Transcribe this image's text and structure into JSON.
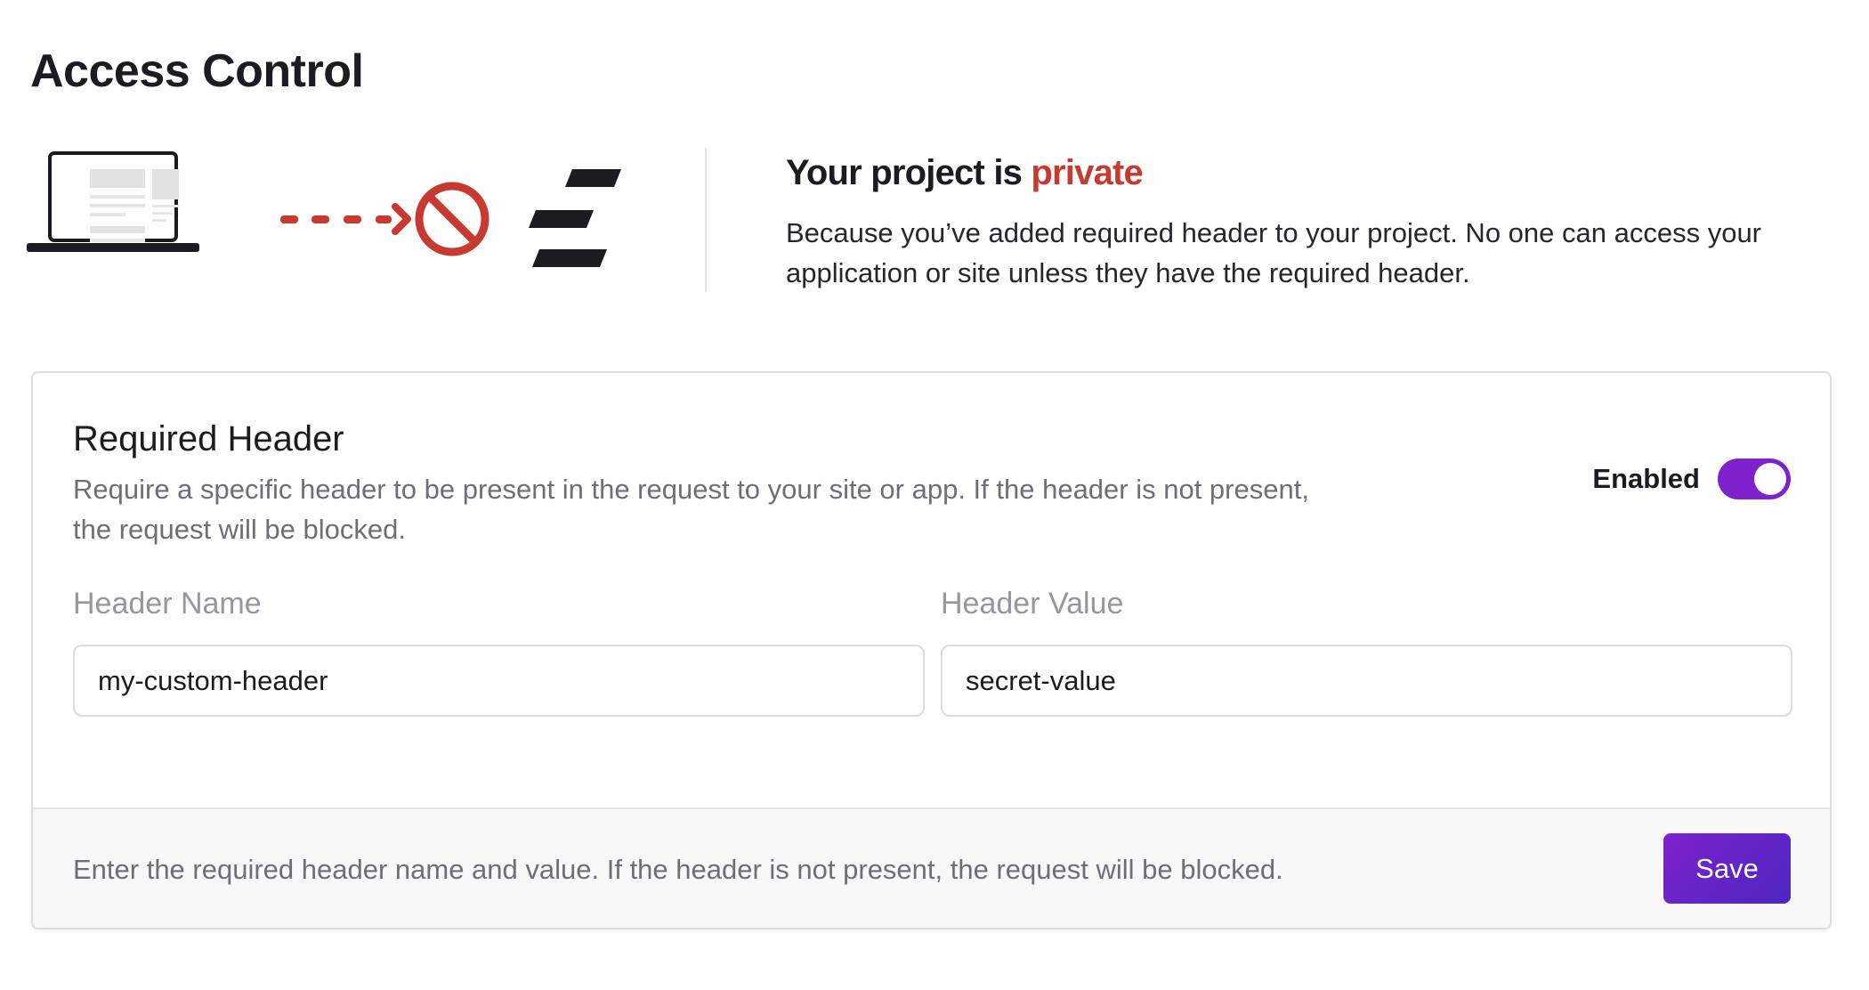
{
  "page": {
    "title": "Access Control"
  },
  "illustration": {
    "icons": [
      "laptop-icon",
      "dashed-arrow-icon",
      "blocked-icon",
      "logo-icon"
    ],
    "colors": {
      "accent_red": "#c8392f",
      "dark": "#1c1b22"
    }
  },
  "status": {
    "title_prefix": "Your project is ",
    "title_highlight": "private",
    "description": "Because you’ve added required header to your project. No one can access your application or site unless they have the required header."
  },
  "card": {
    "title": "Required Header",
    "description": "Require a specific header to be present in the request to your site or app. If the header is not present, the request will be blocked.",
    "toggle": {
      "label": "Enabled",
      "checked": true,
      "color": "#7e22ce"
    },
    "fields": {
      "name": {
        "label": "Header Name",
        "value": "my-custom-header"
      },
      "value": {
        "label": "Header Value",
        "value": "secret-value"
      }
    },
    "footer": {
      "text": "Enter the required header name and value. If the header is not present, the request will be blocked.",
      "save_label": "Save"
    }
  }
}
